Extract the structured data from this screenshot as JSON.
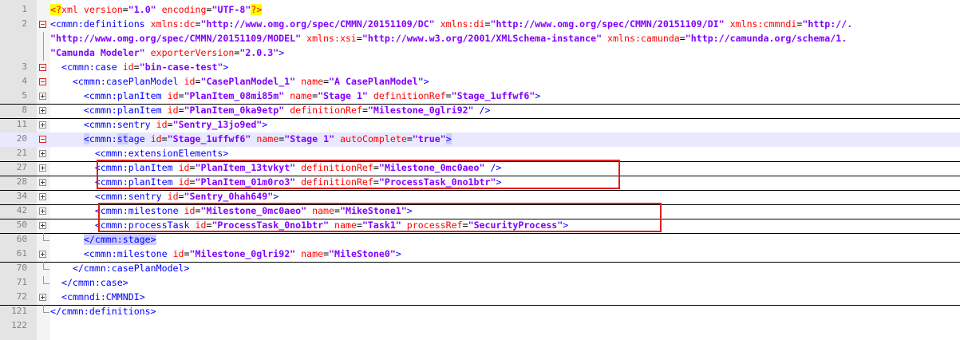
{
  "editor": {
    "lines": [
      {
        "num": "1",
        "text": "<?xml version=\"1.0\" encoding=\"UTF-8\"?>"
      },
      {
        "num": "2",
        "text": "<cmmn:definitions xmlns:dc=\"http://www.omg.org/spec/CMMN/20151109/DC\" xmlns:di=\"http://www.omg.org/spec/CMMN/20151109/DI\" xmlns:cmmndi=\"http://."
      },
      {
        "num": "",
        "text": "\"http://www.omg.org/spec/CMMN/20151109/MODEL\" xmlns:xsi=\"http://www.w3.org/2001/XMLSchema-instance\" xmlns:camunda=\"http://camunda.org/schema/1."
      },
      {
        "num": "",
        "text": "\"Camunda Modeler\" exporterVersion=\"2.0.3\">"
      },
      {
        "num": "3",
        "text": "<cmmn:case id=\"bin-case-test\">"
      },
      {
        "num": "4",
        "text": "<cmmn:casePlanModel id=\"CasePlanModel_1\" name=\"A CasePlanModel\">"
      },
      {
        "num": "5",
        "text": "<cmmn:planItem id=\"PlanItem_08mi85m\" name=\"Stage 1\" definitionRef=\"Stage_1uffwf6\">"
      },
      {
        "num": "8",
        "text": "<cmmn:planItem id=\"PlanItem_0ka9etp\" definitionRef=\"Milestone_0glri92\" />"
      },
      {
        "num": "11",
        "text": "<cmmn:sentry id=\"Sentry_13jo9ed\">"
      },
      {
        "num": "20",
        "text": "<cmmn:stage id=\"Stage_1uffwf6\" name=\"Stage 1\" autoComplete=\"true\">"
      },
      {
        "num": "21",
        "text": "<cmmn:extensionElements>"
      },
      {
        "num": "27",
        "text": "<cmmn:planItem id=\"PlanItem_13tvkyt\" definitionRef=\"Milestone_0mc0aeo\" />"
      },
      {
        "num": "28",
        "text": "<cmmn:planItem id=\"PlanItem_01m0ro3\" definitionRef=\"ProcessTask_0no1btr\">"
      },
      {
        "num": "34",
        "text": "<cmmn:sentry id=\"Sentry_0hah649\">"
      },
      {
        "num": "42",
        "text": "<cmmn:milestone id=\"Milestone_0mc0aeo\" name=\"MikeStone1\">"
      },
      {
        "num": "50",
        "text": "<cmmn:processTask id=\"ProcessTask_0no1btr\" name=\"Task1\" processRef=\"SecurityProcess\">"
      },
      {
        "num": "60",
        "text": "</cmmn:stage>"
      },
      {
        "num": "61",
        "text": "<cmmn:milestone id=\"Milestone_0glri92\" name=\"MileStone0\">"
      },
      {
        "num": "70",
        "text": "</cmmn:casePlanModel>"
      },
      {
        "num": "71",
        "text": "</cmmn:case>"
      },
      {
        "num": "72",
        "text": "<cmmndi:CMMNDI>"
      },
      {
        "num": "121",
        "text": "</cmmn:definitions>"
      },
      {
        "num": "122",
        "text": ""
      }
    ]
  },
  "colors": {
    "tag": "#0000ff",
    "attribute": "#ff0000",
    "value": "#8000ff",
    "highlight": "#e8e8ff",
    "annotation_box": "#e01e1e"
  }
}
